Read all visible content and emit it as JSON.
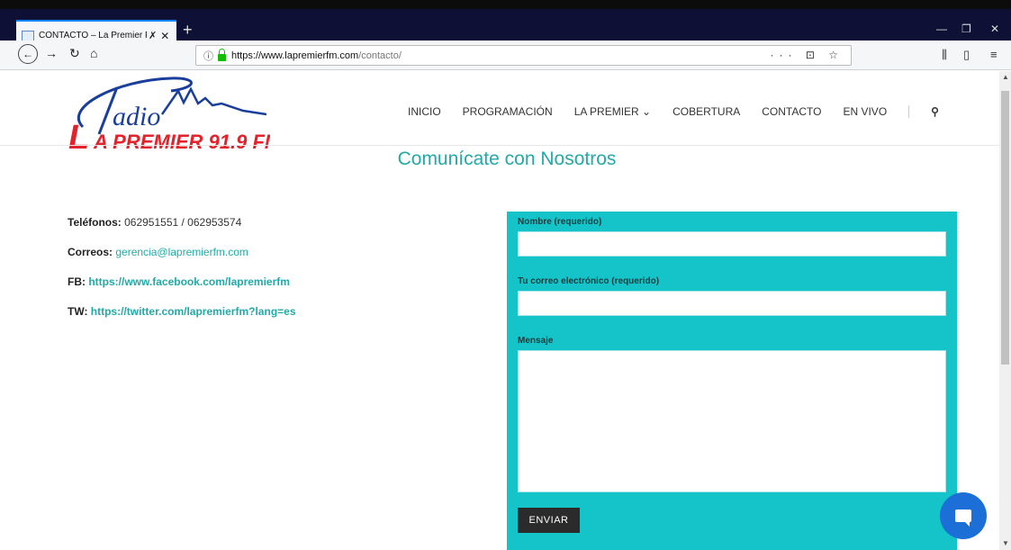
{
  "browser": {
    "tab_title": "CONTACTO – La Premier FM",
    "tab_mute_icon": "speaker-muted-icon",
    "new_tab_label": "+",
    "url_host": "https://www.lapremierfm.com",
    "url_path": "/contacto/",
    "url_actions": "··· ⊡ ☆"
  },
  "site": {
    "logo_text_radio": "adio",
    "logo_text_r": "R",
    "logo_text_main": "A PREMIER 91.9 FM",
    "logo_text_l": "L",
    "nav": {
      "inicio": "INICIO",
      "programacion": "PROGRAMACIÓN",
      "la_premier": "LA PREMIER ⌄",
      "cobertura": "COBERTURA",
      "contacto": "CONTACTO",
      "en_vivo": "EN VIVO"
    },
    "page_title": "Comunícate con Nosotros"
  },
  "contact": {
    "phones_label": "Teléfonos:",
    "phones_value": " 062951551 / 062953574",
    "emails_label": "Correos:",
    "emails_value": "gerencia@lapremierfm.com",
    "fb_label": "FB:",
    "fb_value": "https://www.facebook.com/lapremierfm",
    "tw_label": "TW:",
    "tw_value": "https://twitter.com/lapremierfm?lang=es"
  },
  "form": {
    "name_label": "Nombre (requerido)",
    "email_label": "Tu correo electrónico (requerido)",
    "message_label": "Mensaje",
    "submit_label": "ENVIAR"
  },
  "colors": {
    "accent": "#23a9a9",
    "form_bg": "#14c4c8",
    "logo_red": "#e3222b",
    "logo_blue": "#1a3e9c",
    "chat_blue": "#1d6fd8"
  }
}
